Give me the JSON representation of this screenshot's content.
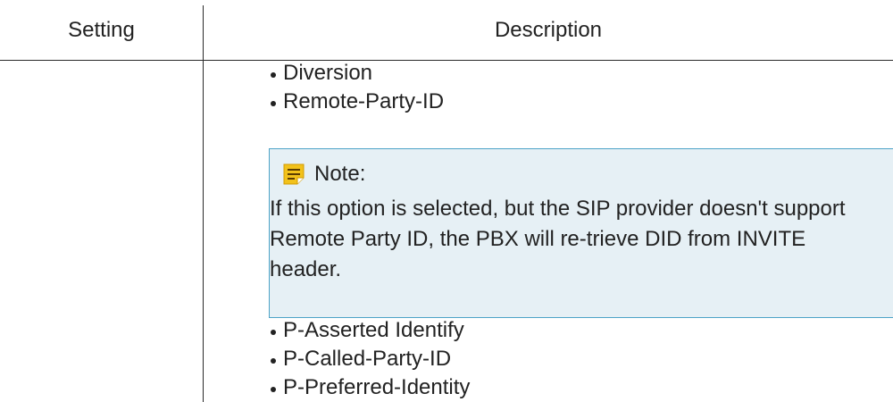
{
  "table": {
    "headers": {
      "setting": "Setting",
      "description": "Description"
    },
    "description_items_before_note": [
      "Diversion",
      "Remote-Party-ID"
    ],
    "note": {
      "icon": "note-icon",
      "label": "Note:",
      "text": "If this option is selected, but the SIP provider doesn't support Remote Party ID, the PBX will re-trieve DID from INVITE header."
    },
    "description_items_after_note": [
      "P-Asserted Identify",
      "P-Called-Party-ID",
      "P-Preferred-Identity"
    ]
  },
  "colors": {
    "note_background": "#e6f0f5",
    "note_border": "#4da3c7",
    "note_icon": "#f2c21b",
    "rule": "#2a2a2a"
  }
}
